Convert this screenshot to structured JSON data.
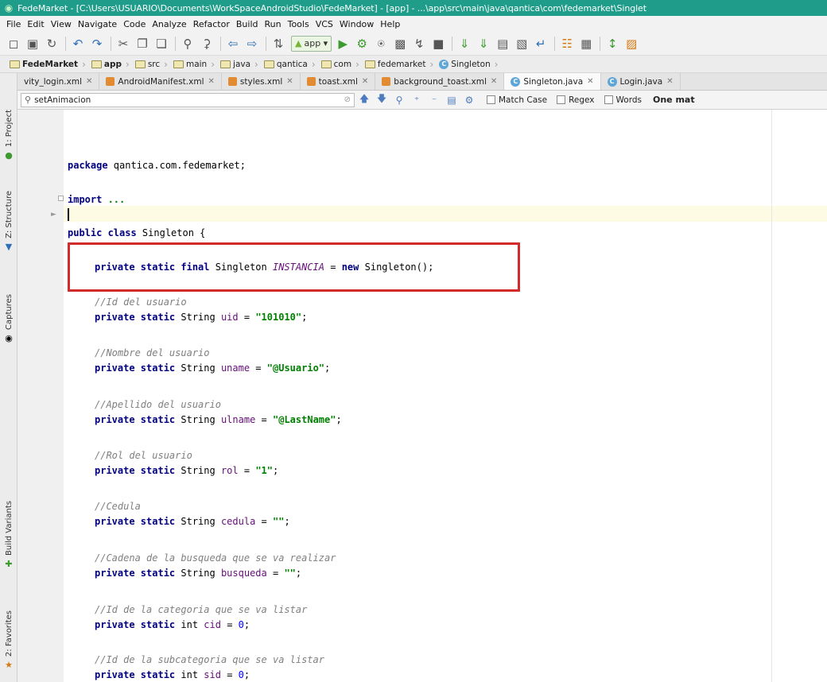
{
  "window": {
    "title": "FedeMarket - [C:\\Users\\USUARIO\\Documents\\WorkSpaceAndroidStudio\\FedeMarket] - [app] - ...\\app\\src\\main\\java\\qantica\\com\\fedemarket\\Singlet"
  },
  "menu": [
    "File",
    "Edit",
    "View",
    "Navigate",
    "Code",
    "Analyze",
    "Refactor",
    "Build",
    "Run",
    "Tools",
    "VCS",
    "Window",
    "Help"
  ],
  "toolbar": {
    "run_config": "app"
  },
  "breadcrumbs": [
    "FedeMarket",
    "app",
    "src",
    "main",
    "java",
    "qantica",
    "com",
    "fedemarket",
    "Singleton"
  ],
  "tabs": [
    {
      "label": "vity_login.xml",
      "type": "xml",
      "active": false
    },
    {
      "label": "AndroidManifest.xml",
      "type": "xml",
      "active": false
    },
    {
      "label": "styles.xml",
      "type": "xml",
      "active": false
    },
    {
      "label": "toast.xml",
      "type": "xml",
      "active": false
    },
    {
      "label": "background_toast.xml",
      "type": "xml",
      "active": false
    },
    {
      "label": "Singleton.java",
      "type": "java",
      "active": true
    },
    {
      "label": "Login.java",
      "type": "java",
      "active": false
    }
  ],
  "search": {
    "value": "setAnimacion",
    "match_case": "Match Case",
    "regex": "Regex",
    "words": "Words",
    "status": "One mat"
  },
  "side_tabs": {
    "project": "1: Project",
    "structure": "Z: Structure",
    "captures": "Captures",
    "build_variants": "Build Variants",
    "favorites": "2: Favorites"
  },
  "code": {
    "package_kw": "package",
    "package_name": " qantica.com.fedemarket;",
    "import_kw": "import",
    "import_rest": " ...",
    "class_decl": "public class",
    "class_name": " Singleton {",
    "instancia": {
      "mods": "private static final",
      "type": " Singleton ",
      "name": "INSTANCIA",
      "eq": " = ",
      "new_kw": "new",
      "rest": " Singleton();"
    },
    "fields": [
      {
        "comment": "//Id del usuario",
        "mods": "private static",
        "type": " String ",
        "name": "uid",
        "eq": " = ",
        "value": "\"101010\"",
        "end": ";"
      },
      {
        "comment": "//Nombre del usuario",
        "mods": "private static",
        "type": " String ",
        "name": "uname",
        "eq": " = ",
        "value": "\"@Usuario\"",
        "end": ";"
      },
      {
        "comment": "//Apellido del usuario",
        "mods": "private static",
        "type": " String ",
        "name": "ulname",
        "eq": " = ",
        "value": "\"@LastName\"",
        "end": ";"
      },
      {
        "comment": "//Rol del usuario",
        "mods": "private static",
        "type": " String ",
        "name": "rol",
        "eq": " = ",
        "value": "\"1\"",
        "end": ";"
      },
      {
        "comment": "//Cedula",
        "mods": "private static",
        "type": " String ",
        "name": "cedula",
        "eq": " = ",
        "value": "\"\"",
        "end": ";"
      },
      {
        "comment": "//Cadena de la busqueda que se va realizar",
        "mods": "private static",
        "type": " String ",
        "name": "busqueda",
        "eq": " = ",
        "value": "\"\"",
        "end": ";"
      },
      {
        "comment": "//Id de la categoria que se va listar",
        "mods": "private static",
        "type": " int ",
        "name": "cid",
        "eq": " = ",
        "value": "0",
        "end": ";"
      },
      {
        "comment": "//Id de la subcategoria que se va listar",
        "mods": "private static",
        "type": " int ",
        "name": "sid",
        "eq": " = ",
        "value": "0",
        "end": ";"
      }
    ]
  }
}
